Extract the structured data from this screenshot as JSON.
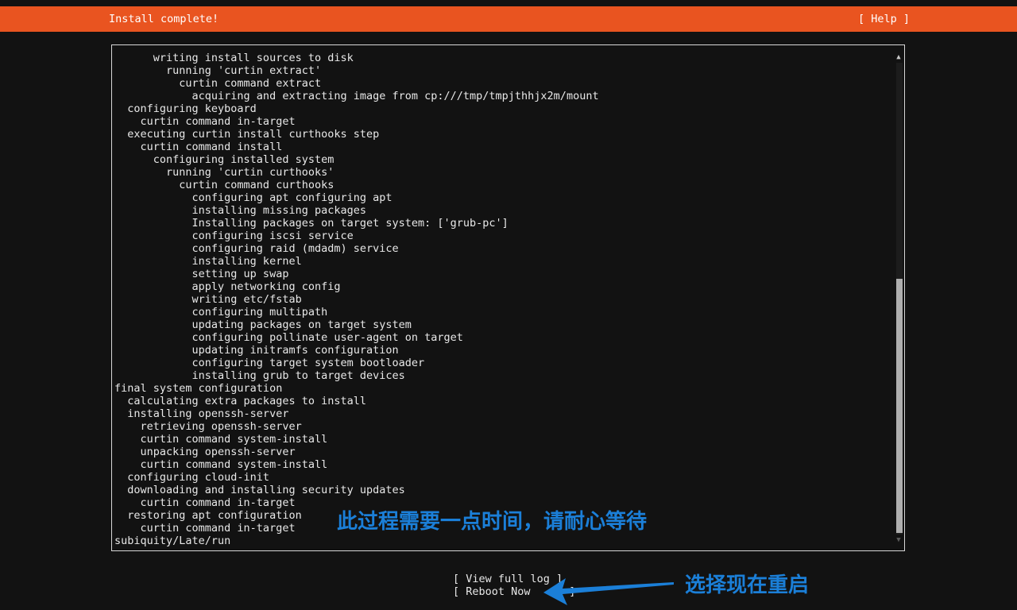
{
  "header": {
    "title": "Install complete!",
    "help_label": "[ Help ]",
    "background_color": "#e95420"
  },
  "log": {
    "lines": [
      "      writing install sources to disk",
      "        running 'curtin extract'",
      "          curtin command extract",
      "            acquiring and extracting image from cp:///tmp/tmpjthhjx2m/mount",
      "  configuring keyboard",
      "    curtin command in-target",
      "  executing curtin install curthooks step",
      "    curtin command install",
      "      configuring installed system",
      "        running 'curtin curthooks'",
      "          curtin command curthooks",
      "            configuring apt configuring apt",
      "            installing missing packages",
      "            Installing packages on target system: ['grub-pc']",
      "            configuring iscsi service",
      "            configuring raid (mdadm) service",
      "            installing kernel",
      "            setting up swap",
      "            apply networking config",
      "            writing etc/fstab",
      "            configuring multipath",
      "            updating packages on target system",
      "            configuring pollinate user-agent on target",
      "            updating initramfs configuration",
      "            configuring target system bootloader",
      "            installing grub to target devices",
      "final system configuration",
      "  calculating extra packages to install",
      "  installing openssh-server",
      "    retrieving openssh-server",
      "    curtin command system-install",
      "    unpacking openssh-server",
      "    curtin command system-install",
      "  configuring cloud-init",
      "  downloading and installing security updates",
      "    curtin command in-target",
      "  restoring apt configuration",
      "    curtin command in-target",
      "subiquity/Late/run"
    ],
    "scroll_up_glyph": "▲",
    "scroll_down_glyph": "▼"
  },
  "actions": {
    "view_full_log_label": "[ View full log ]",
    "reboot_now_label": "[ Reboot Now      ]"
  },
  "annotations": {
    "wait_note": "此过程需要一点时间，请耐心等待",
    "reboot_note": "选择现在重启",
    "color": "#1b7fd8"
  }
}
